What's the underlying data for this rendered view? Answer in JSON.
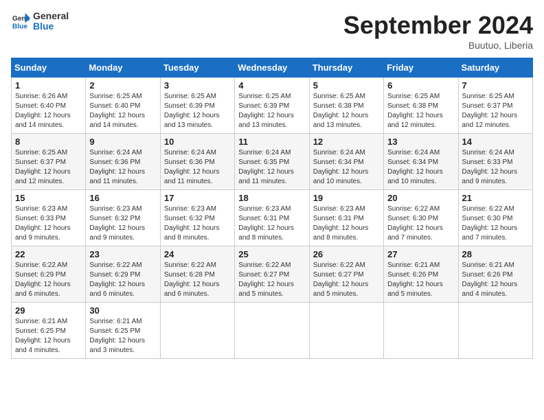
{
  "header": {
    "logo_line1": "General",
    "logo_line2": "Blue",
    "month_title": "September 2024",
    "location": "Buutuo, Liberia"
  },
  "days_of_week": [
    "Sunday",
    "Monday",
    "Tuesday",
    "Wednesday",
    "Thursday",
    "Friday",
    "Saturday"
  ],
  "weeks": [
    [
      {
        "day": "1",
        "sunrise": "6:26 AM",
        "sunset": "6:40 PM",
        "daylight": "12 hours and 14 minutes."
      },
      {
        "day": "2",
        "sunrise": "6:25 AM",
        "sunset": "6:40 PM",
        "daylight": "12 hours and 14 minutes."
      },
      {
        "day": "3",
        "sunrise": "6:25 AM",
        "sunset": "6:39 PM",
        "daylight": "12 hours and 13 minutes."
      },
      {
        "day": "4",
        "sunrise": "6:25 AM",
        "sunset": "6:39 PM",
        "daylight": "12 hours and 13 minutes."
      },
      {
        "day": "5",
        "sunrise": "6:25 AM",
        "sunset": "6:38 PM",
        "daylight": "12 hours and 13 minutes."
      },
      {
        "day": "6",
        "sunrise": "6:25 AM",
        "sunset": "6:38 PM",
        "daylight": "12 hours and 12 minutes."
      },
      {
        "day": "7",
        "sunrise": "6:25 AM",
        "sunset": "6:37 PM",
        "daylight": "12 hours and 12 minutes."
      }
    ],
    [
      {
        "day": "8",
        "sunrise": "6:25 AM",
        "sunset": "6:37 PM",
        "daylight": "12 hours and 12 minutes."
      },
      {
        "day": "9",
        "sunrise": "6:24 AM",
        "sunset": "6:36 PM",
        "daylight": "12 hours and 11 minutes."
      },
      {
        "day": "10",
        "sunrise": "6:24 AM",
        "sunset": "6:36 PM",
        "daylight": "12 hours and 11 minutes."
      },
      {
        "day": "11",
        "sunrise": "6:24 AM",
        "sunset": "6:35 PM",
        "daylight": "12 hours and 11 minutes."
      },
      {
        "day": "12",
        "sunrise": "6:24 AM",
        "sunset": "6:34 PM",
        "daylight": "12 hours and 10 minutes."
      },
      {
        "day": "13",
        "sunrise": "6:24 AM",
        "sunset": "6:34 PM",
        "daylight": "12 hours and 10 minutes."
      },
      {
        "day": "14",
        "sunrise": "6:24 AM",
        "sunset": "6:33 PM",
        "daylight": "12 hours and 9 minutes."
      }
    ],
    [
      {
        "day": "15",
        "sunrise": "6:23 AM",
        "sunset": "6:33 PM",
        "daylight": "12 hours and 9 minutes."
      },
      {
        "day": "16",
        "sunrise": "6:23 AM",
        "sunset": "6:32 PM",
        "daylight": "12 hours and 9 minutes."
      },
      {
        "day": "17",
        "sunrise": "6:23 AM",
        "sunset": "6:32 PM",
        "daylight": "12 hours and 8 minutes."
      },
      {
        "day": "18",
        "sunrise": "6:23 AM",
        "sunset": "6:31 PM",
        "daylight": "12 hours and 8 minutes."
      },
      {
        "day": "19",
        "sunrise": "6:23 AM",
        "sunset": "6:31 PM",
        "daylight": "12 hours and 8 minutes."
      },
      {
        "day": "20",
        "sunrise": "6:22 AM",
        "sunset": "6:30 PM",
        "daylight": "12 hours and 7 minutes."
      },
      {
        "day": "21",
        "sunrise": "6:22 AM",
        "sunset": "6:30 PM",
        "daylight": "12 hours and 7 minutes."
      }
    ],
    [
      {
        "day": "22",
        "sunrise": "6:22 AM",
        "sunset": "6:29 PM",
        "daylight": "12 hours and 6 minutes."
      },
      {
        "day": "23",
        "sunrise": "6:22 AM",
        "sunset": "6:29 PM",
        "daylight": "12 hours and 6 minutes."
      },
      {
        "day": "24",
        "sunrise": "6:22 AM",
        "sunset": "6:28 PM",
        "daylight": "12 hours and 6 minutes."
      },
      {
        "day": "25",
        "sunrise": "6:22 AM",
        "sunset": "6:27 PM",
        "daylight": "12 hours and 5 minutes."
      },
      {
        "day": "26",
        "sunrise": "6:22 AM",
        "sunset": "6:27 PM",
        "daylight": "12 hours and 5 minutes."
      },
      {
        "day": "27",
        "sunrise": "6:21 AM",
        "sunset": "6:26 PM",
        "daylight": "12 hours and 5 minutes."
      },
      {
        "day": "28",
        "sunrise": "6:21 AM",
        "sunset": "6:26 PM",
        "daylight": "12 hours and 4 minutes."
      }
    ],
    [
      {
        "day": "29",
        "sunrise": "6:21 AM",
        "sunset": "6:25 PM",
        "daylight": "12 hours and 4 minutes."
      },
      {
        "day": "30",
        "sunrise": "6:21 AM",
        "sunset": "6:25 PM",
        "daylight": "12 hours and 3 minutes."
      },
      null,
      null,
      null,
      null,
      null
    ]
  ]
}
